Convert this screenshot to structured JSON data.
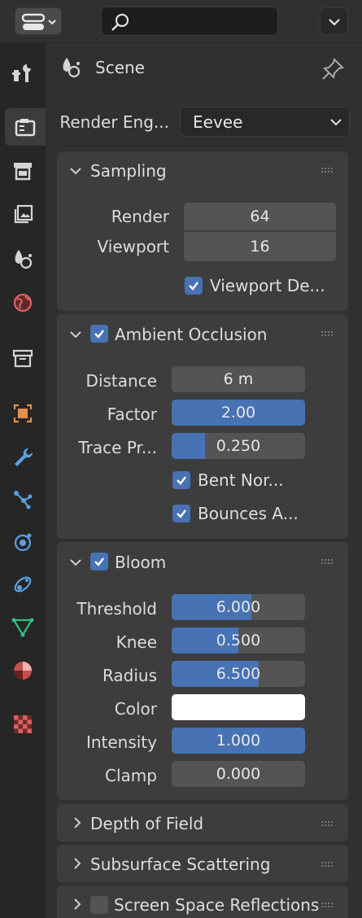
{
  "search": {
    "placeholder": ""
  },
  "header": {
    "title": "Scene"
  },
  "render_engine": {
    "label": "Render Eng...",
    "value": "Eevee"
  },
  "sampling": {
    "title": "Sampling",
    "render_label": "Render",
    "render_value": "64",
    "viewport_label": "Viewport",
    "viewport_value": "16",
    "viewport_denoise_label": "Viewport De..."
  },
  "ambient_occlusion": {
    "title": "Ambient Occlusion",
    "distance_label": "Distance",
    "distance_value": "6 m",
    "factor_label": "Factor",
    "factor_value": "2.00",
    "factor_fill": 1.0,
    "trace_label": "Trace Pr...",
    "trace_value": "0.250",
    "trace_fill": 0.25,
    "bent_label": "Bent Nor...",
    "bounces_label": "Bounces A..."
  },
  "bloom": {
    "title": "Bloom",
    "threshold_label": "Threshold",
    "threshold_value": "6.000",
    "threshold_fill": 0.6,
    "knee_label": "Knee",
    "knee_value": "0.500",
    "knee_fill": 0.5,
    "radius_label": "Radius",
    "radius_value": "6.500",
    "radius_fill": 0.65,
    "color_label": "Color",
    "color_value": "#ffffff",
    "intensity_label": "Intensity",
    "intensity_value": "1.000",
    "intensity_fill": 1.0,
    "clamp_label": "Clamp",
    "clamp_value": "0.000",
    "clamp_fill": 0.0
  },
  "collapsed_panels": {
    "depth_of_field": "Depth of Field",
    "subsurface": "Subsurface Scattering",
    "ssr": "Screen Space Reflections"
  },
  "colors": {
    "accent": "#4772b3",
    "panel": "#3d3d3d",
    "background": "#303030"
  }
}
